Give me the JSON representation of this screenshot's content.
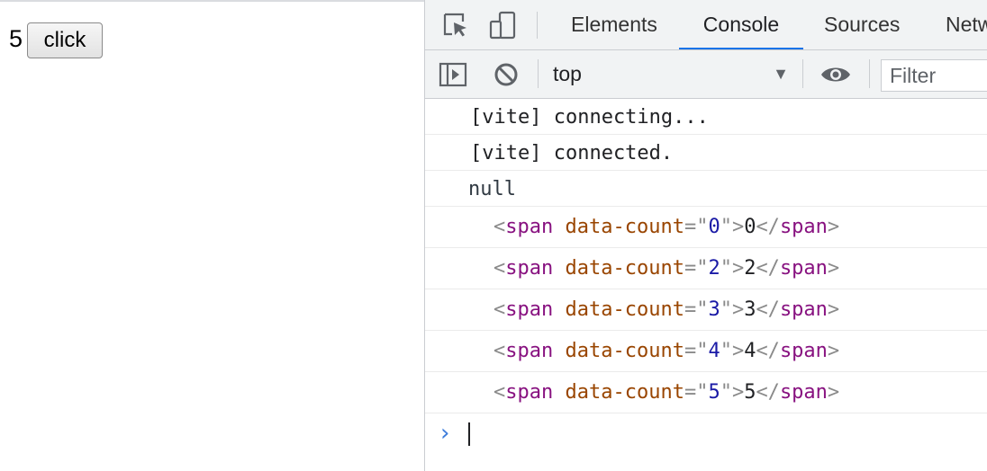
{
  "page": {
    "count": "5",
    "button_label": "click"
  },
  "devtools": {
    "icons": [
      "inspect-element-icon",
      "device-toggle-icon"
    ],
    "tabs": [
      {
        "label": "Elements",
        "active": false
      },
      {
        "label": "Console",
        "active": true
      },
      {
        "label": "Sources",
        "active": false
      },
      {
        "label": "Netw",
        "active": false
      }
    ],
    "toolbar": {
      "sidebar_icon": "sidebar-toggle-icon",
      "clear_icon": "clear-console-icon",
      "context": "top",
      "context_arrow": "▼",
      "eye_icon": "live-expression-icon",
      "filter_placeholder": "Filter"
    },
    "logs": [
      {
        "text": "[vite] connecting..."
      },
      {
        "text": "[vite] connected."
      },
      {
        "text": "null"
      }
    ],
    "elements": [
      {
        "open_lt": "<",
        "tag": "span",
        "attr": "data-count",
        "eq": "=",
        "quote": "\"",
        "value": "0",
        "close_gt": ">",
        "content": "0",
        "end_lt": "</",
        "end_tag": "span",
        "end_gt": ">"
      },
      {
        "open_lt": "<",
        "tag": "span",
        "attr": "data-count",
        "eq": "=",
        "quote": "\"",
        "value": "2",
        "close_gt": ">",
        "content": "2",
        "end_lt": "</",
        "end_tag": "span",
        "end_gt": ">"
      },
      {
        "open_lt": "<",
        "tag": "span",
        "attr": "data-count",
        "eq": "=",
        "quote": "\"",
        "value": "3",
        "close_gt": ">",
        "content": "3",
        "end_lt": "</",
        "end_tag": "span",
        "end_gt": ">"
      },
      {
        "open_lt": "<",
        "tag": "span",
        "attr": "data-count",
        "eq": "=",
        "quote": "\"",
        "value": "4",
        "close_gt": ">",
        "content": "4",
        "end_lt": "</",
        "end_tag": "span",
        "end_gt": ">"
      },
      {
        "open_lt": "<",
        "tag": "span",
        "attr": "data-count",
        "eq": "=",
        "quote": "\"",
        "value": "5",
        "close_gt": ">",
        "content": "5",
        "end_lt": "</",
        "end_tag": "span",
        "end_gt": ">"
      }
    ],
    "prompt_symbol": "›",
    "colors": {
      "accent": "#1a73e8",
      "tag": "#881280",
      "attribute": "#994500",
      "attribute_value": "#1a1aa6",
      "prompt": "#3e7ddb"
    }
  }
}
